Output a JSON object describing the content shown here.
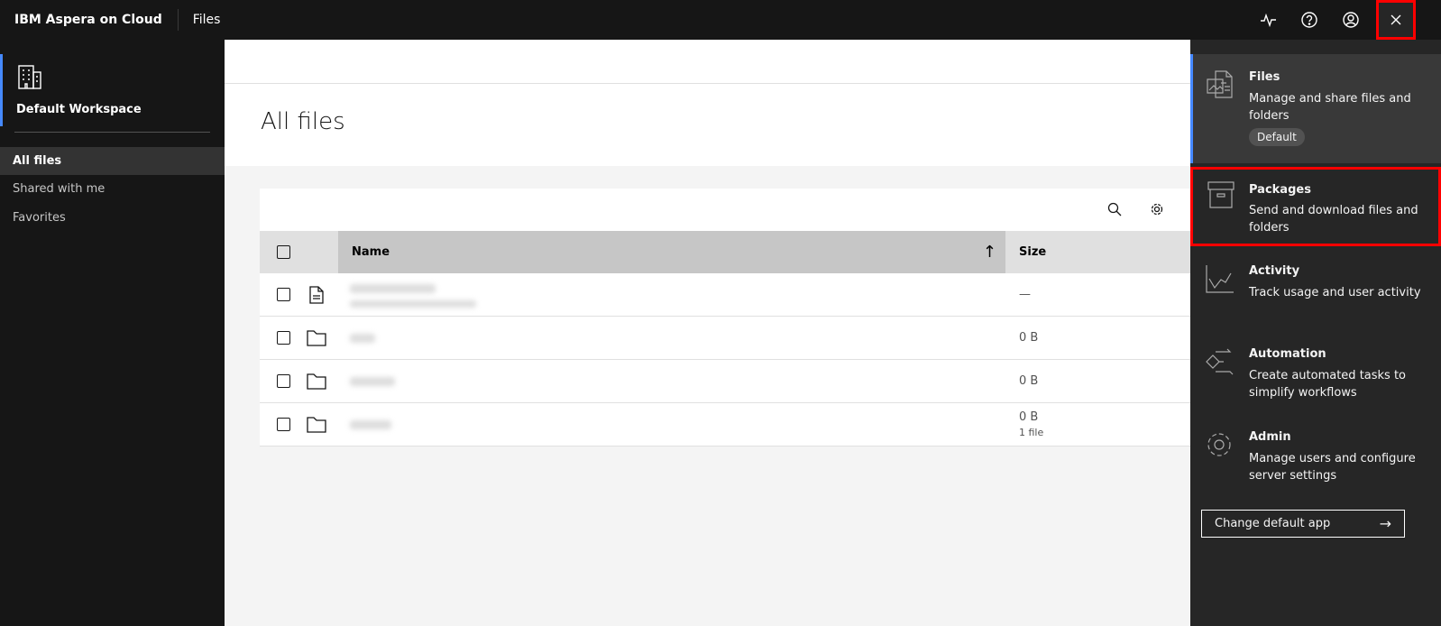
{
  "header": {
    "brand": "IBM Aspera on Cloud",
    "app": "Files"
  },
  "sidebar": {
    "workspace": "Default Workspace",
    "items": [
      {
        "label": "All files"
      },
      {
        "label": "Shared with me"
      },
      {
        "label": "Favorites"
      }
    ]
  },
  "main": {
    "title": "All files",
    "columns": {
      "name": "Name",
      "size": "Size"
    },
    "rows": [
      {
        "type": "file",
        "size": "—",
        "sub": ""
      },
      {
        "type": "folder",
        "size": "0 B",
        "sub": ""
      },
      {
        "type": "folder",
        "size": "0 B",
        "sub": ""
      },
      {
        "type": "folder",
        "size": "0 B",
        "sub": "1 file"
      }
    ]
  },
  "switcher": {
    "apps": [
      {
        "name": "Files",
        "desc": "Manage and share files and folders",
        "badge": "Default",
        "icon": "files-icon"
      },
      {
        "name": "Packages",
        "desc": "Send and download files and folders",
        "icon": "package-icon"
      },
      {
        "name": "Activity",
        "desc": "Track usage and user activity",
        "icon": "activity-icon"
      },
      {
        "name": "Automation",
        "desc": "Create automated tasks to simplify workflows",
        "icon": "automation-icon"
      },
      {
        "name": "Admin",
        "desc": "Manage users and configure server settings",
        "icon": "gear-icon"
      }
    ],
    "change_default": "Change default app"
  },
  "colors": {
    "accent": "#4589ff",
    "highlight": "#ff0000"
  }
}
